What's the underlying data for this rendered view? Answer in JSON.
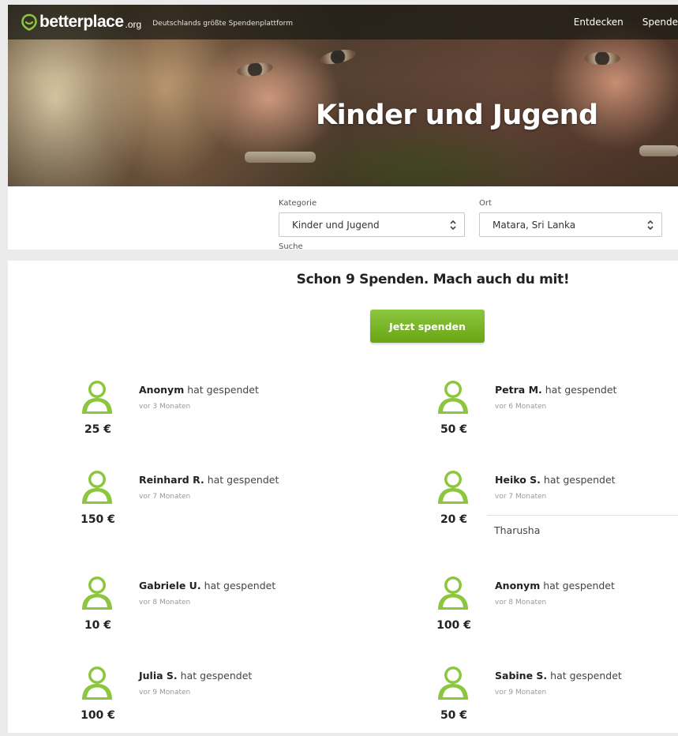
{
  "header": {
    "logo_text": "betterplace",
    "logo_tld": ".org",
    "tagline": "Deutschlands größte Spendenplattform",
    "nav": [
      {
        "label": "Entdecken"
      },
      {
        "label": "Spende"
      }
    ]
  },
  "hero": {
    "title": "Kinder und Jugend"
  },
  "filter": {
    "category_label": "Kategorie",
    "category_value": "Kinder und Jugend",
    "location_label": "Ort",
    "location_value": "Matara, Sri Lanka",
    "search_label": "Suche"
  },
  "donations": {
    "headline": "Schon 9 Spenden. Mach auch du mit!",
    "cta_label": "Jetzt spenden",
    "action_text": "hat gespendet",
    "list": [
      {
        "name": "Anonym",
        "time": "vor 3 Monaten",
        "amount": "25 €"
      },
      {
        "name": "Petra M.",
        "time": "vor 6 Monaten",
        "amount": "50 €"
      },
      {
        "name": "Reinhard R.",
        "time": "vor 7 Monaten",
        "amount": "150 €"
      },
      {
        "name": "Heiko S.",
        "time": "vor 7 Monaten",
        "amount": "20 €",
        "message": "Tharusha"
      },
      {
        "name": "Gabriele U.",
        "time": "vor 8 Monaten",
        "amount": "10 €"
      },
      {
        "name": "Anonym",
        "time": "vor 8 Monaten",
        "amount": "100 €"
      },
      {
        "name": "Julia S.",
        "time": "vor 9 Monaten",
        "amount": "100 €"
      },
      {
        "name": "Sabine S.",
        "time": "vor 9 Monaten",
        "amount": "50 €"
      }
    ]
  },
  "colors": {
    "brand_green": "#7ab51d",
    "header_bg": "#1e1e19",
    "page_bg": "#ebebeb"
  },
  "icons": [
    "betterplace-logo-icon",
    "user-avatar-icon",
    "select-caret-icon"
  ]
}
